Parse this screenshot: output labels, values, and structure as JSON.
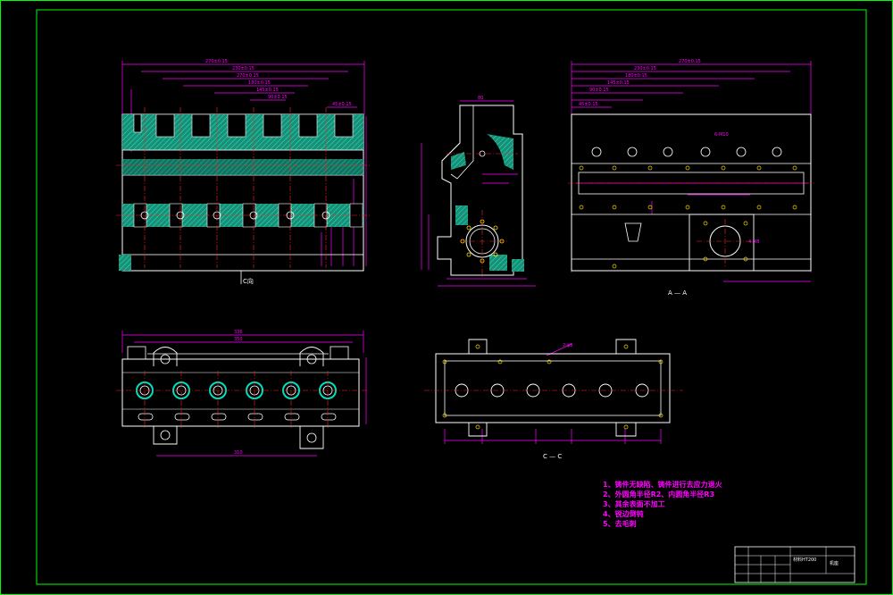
{
  "colors": {
    "background": "#000000",
    "border": "#00ff00",
    "outline": "#ffffff",
    "dimension": "#ff00ff",
    "centerline": "#ff2020",
    "hatch": "#00c8a0",
    "hidden": "#00ffff",
    "fill_teal": "#1f8c78"
  },
  "views": {
    "top_left_label": "C向",
    "top_right_label": "A — A",
    "bottom_right_label": "C — C"
  },
  "dimensions": {
    "tl_overall": "270±0.15",
    "tl_d2": "230±0.15",
    "tl_d3": "270±0.15",
    "tl_d4": "180±0.15",
    "tl_d5": "145±0.15",
    "tl_d6": "90±0.15",
    "tl_d7": "45±0.15",
    "tr_overall": "270±0.15",
    "tr_d2": "230±0.15",
    "tr_d3": "180±0.15",
    "tr_d4": "145±0.15",
    "tr_d5": "90±0.15",
    "tr_d6": "45±0.15",
    "tr_hole": "6-M10",
    "tr_hole2": "4-M8",
    "bl_width": "336",
    "bl_d2": "350",
    "bl_bottom": "310",
    "br_hole": "2-φ8",
    "mid_top": "80"
  },
  "notes": [
    "1、铸件无缺陷、铸件进行去应力退火",
    "2、外圆角半径R2、内圆角半径R3",
    "3、其余表面不加工",
    "4、锐边倒钝",
    "5、去毛刺"
  ],
  "title_block": {
    "material": "材料HT200",
    "part_name": "机座"
  }
}
